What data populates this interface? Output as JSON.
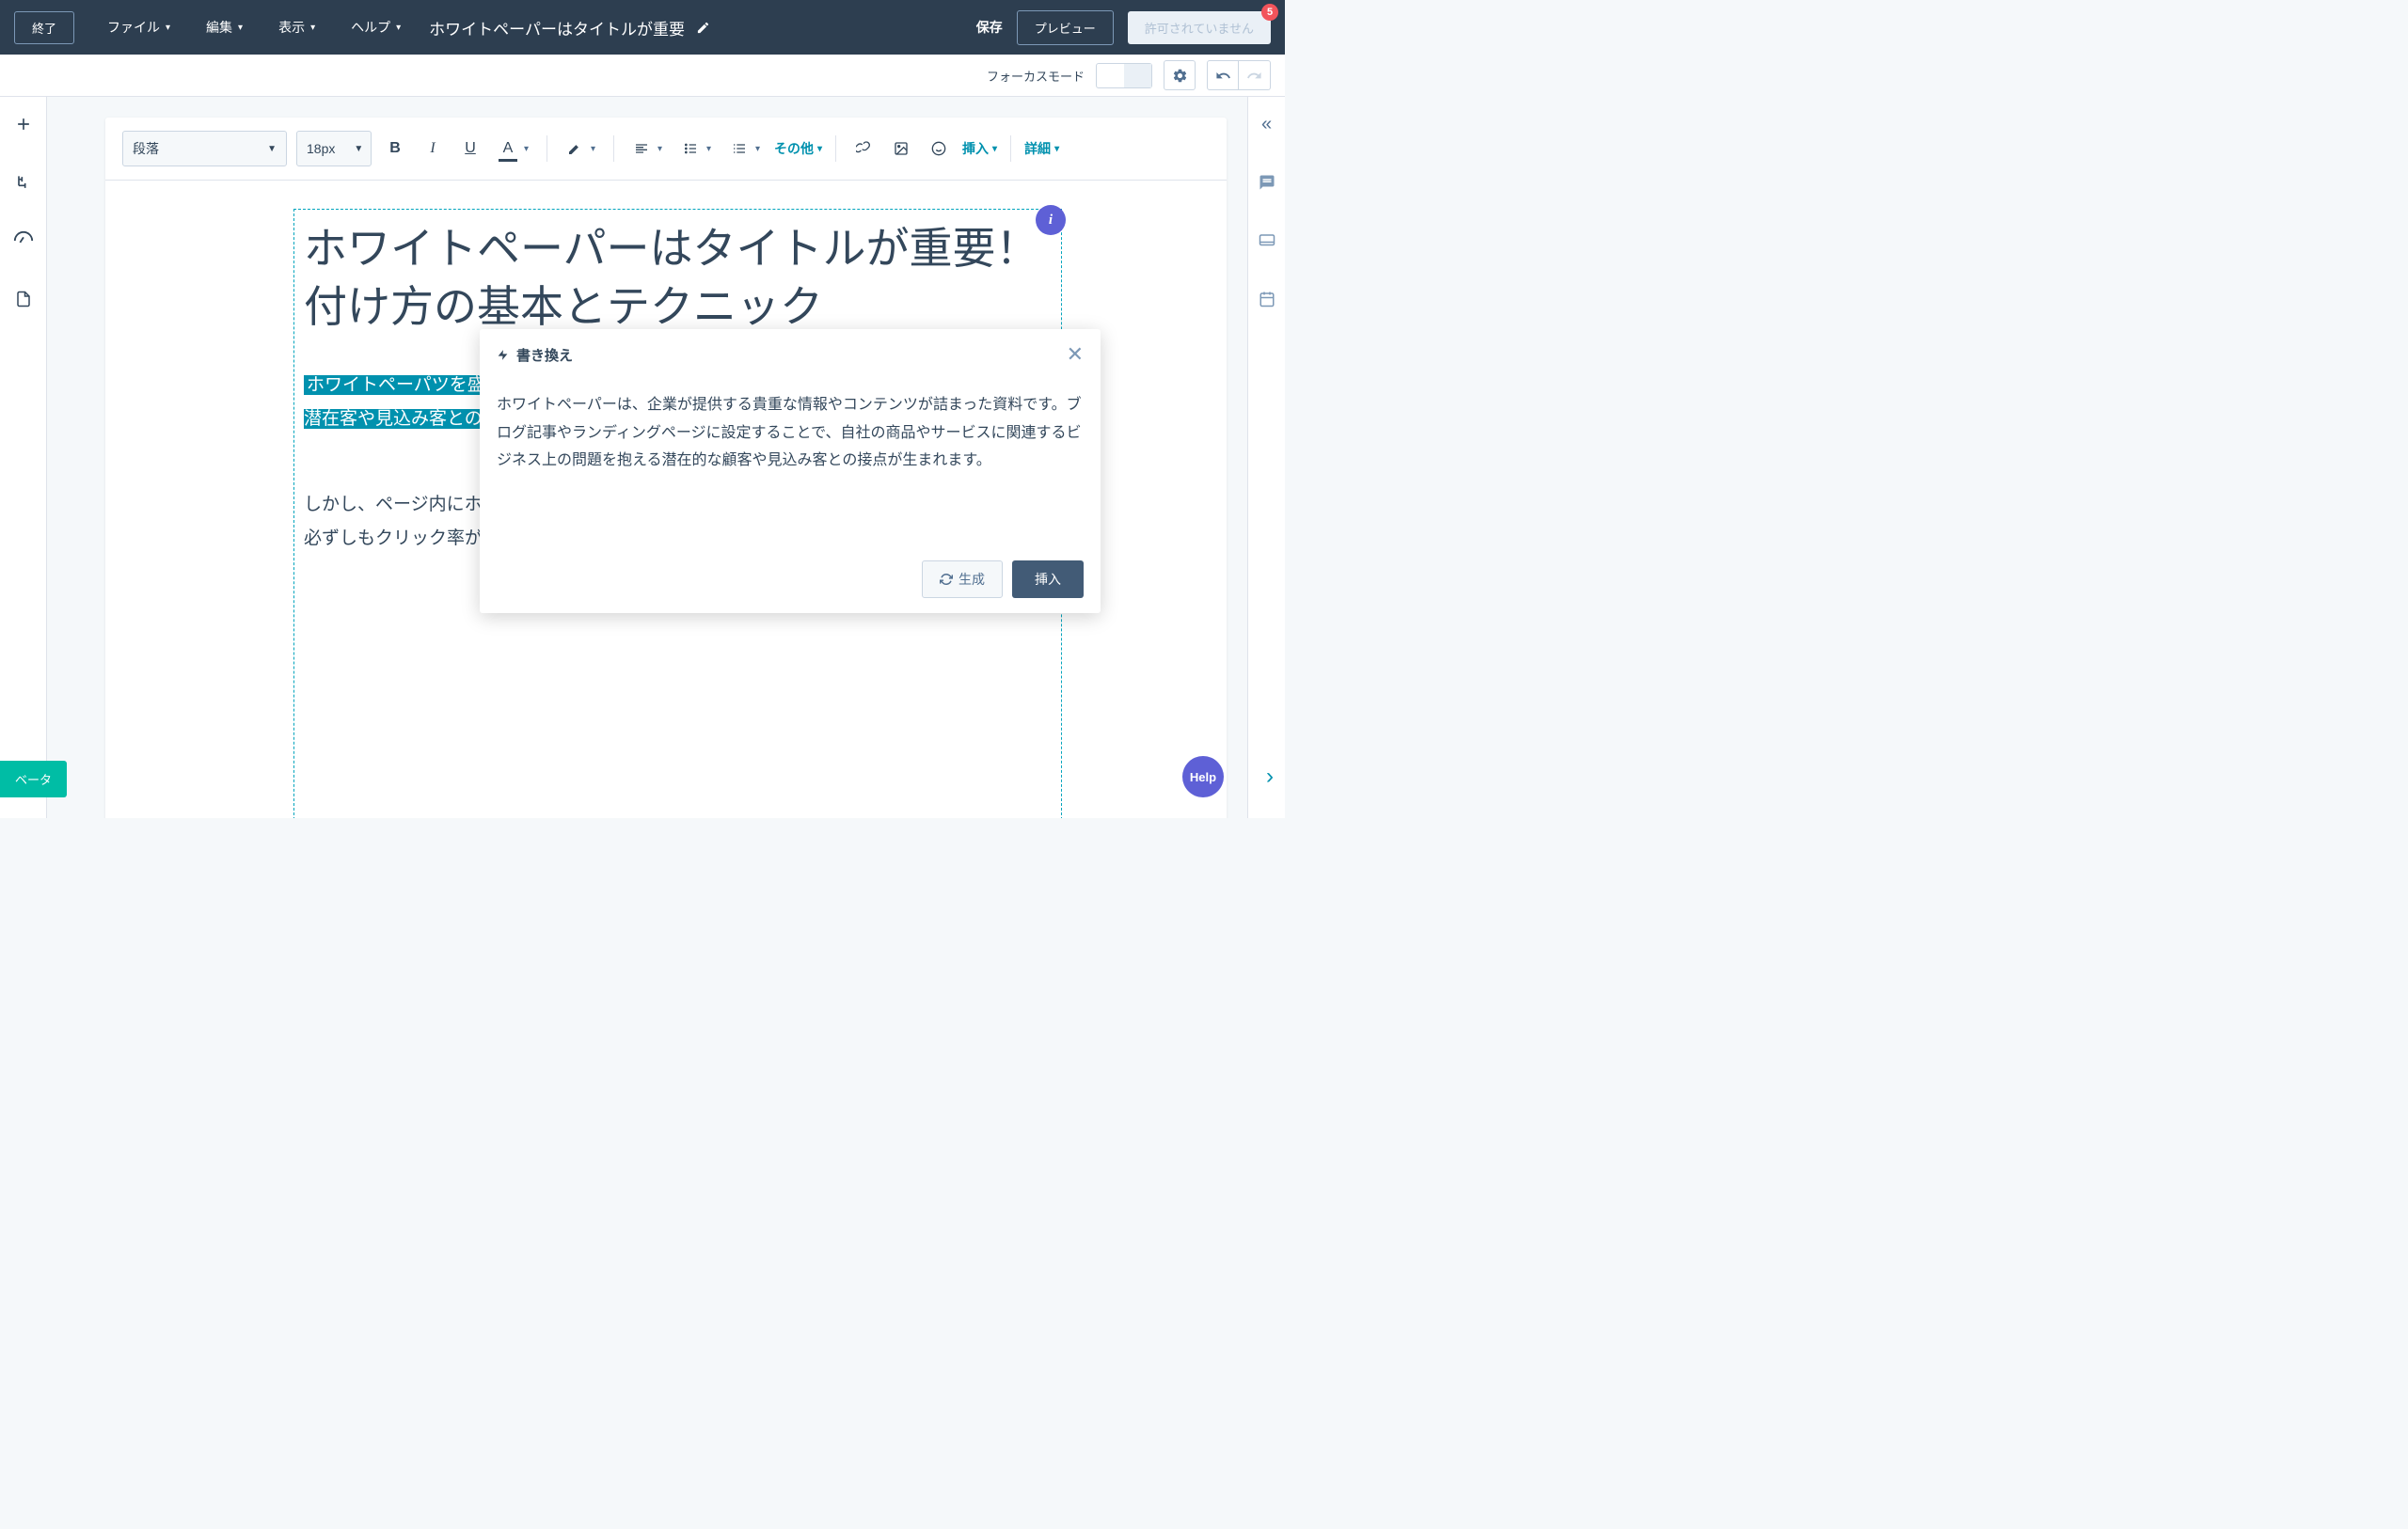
{
  "header": {
    "exit": "終了",
    "menus": {
      "file": "ファイル",
      "edit": "編集",
      "view": "表示",
      "help": "ヘルプ"
    },
    "docTitle": "ホワイトペーパーはタイトルが重要",
    "save": "保存",
    "preview": "プレビュー",
    "disabled": "許可されていません",
    "notificationCount": "5"
  },
  "subToolbar": {
    "focusMode": "フォーカスモード"
  },
  "formatToolbar": {
    "paragraphStyle": "段落",
    "fontSize": "18px",
    "other": "その他",
    "insert": "挿入",
    "detail": "詳細"
  },
  "content": {
    "heading": "ホワイトペーパーはタイトルが重要！付け方の基本とテクニック",
    "highlighted": "ホワイトペーパツを盛り込んだグページに設定ビジネス上の課題を抱えている、潜在客や見込み客とのつながりが生まれます。",
    "normal": "しかし、ページ内にホワイトペーパーのCTA（行動喚起）リンクを設置すれば、必ずしもクリック率が高まるわけではありま"
  },
  "rewritePopup": {
    "title": "書き換え",
    "body": "ホワイトペーパーは、企業が提供する貴重な情報やコンテンツが詰まった資料です。ブログ記事やランディングページに設定することで、自社の商品やサービスに関連するビジネス上の問題を抱える潜在的な顧客や見込み客との接点が生まれます。",
    "generate": "生成",
    "insert": "挿入"
  },
  "chips": {
    "beta": "ベータ",
    "help": "Help"
  }
}
